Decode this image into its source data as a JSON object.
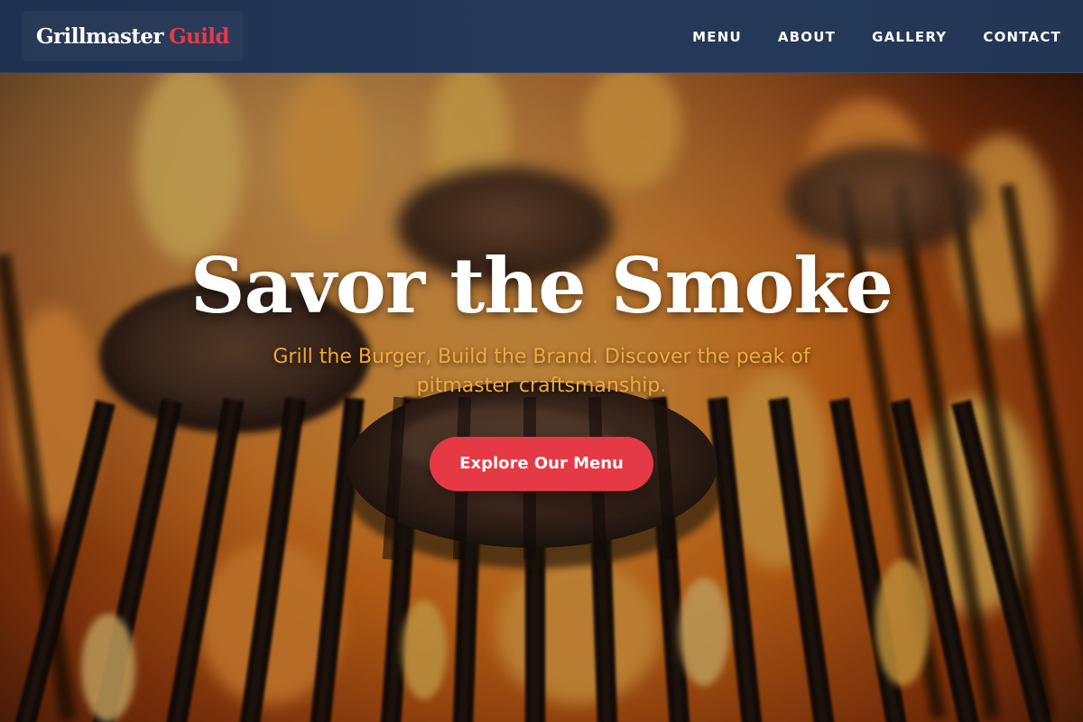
{
  "header": {
    "brand_main": "Grillmaster",
    "brand_accent": "Guild",
    "nav": [
      {
        "label": "MENU"
      },
      {
        "label": "ABOUT"
      },
      {
        "label": "GALLERY"
      },
      {
        "label": "CONTACT"
      }
    ]
  },
  "hero": {
    "title": "Savor the Smoke",
    "tagline": "Grill the Burger, Build the Brand. Discover the peak of pitmaster craftsmanship.",
    "cta_label": "Explore Our Menu",
    "background_image": "burger-patties-on-flaming-grill"
  },
  "colors": {
    "header_bg": "#23365a",
    "accent": "#e63946",
    "tagline": "#f2a93b",
    "text": "#ffffff"
  }
}
